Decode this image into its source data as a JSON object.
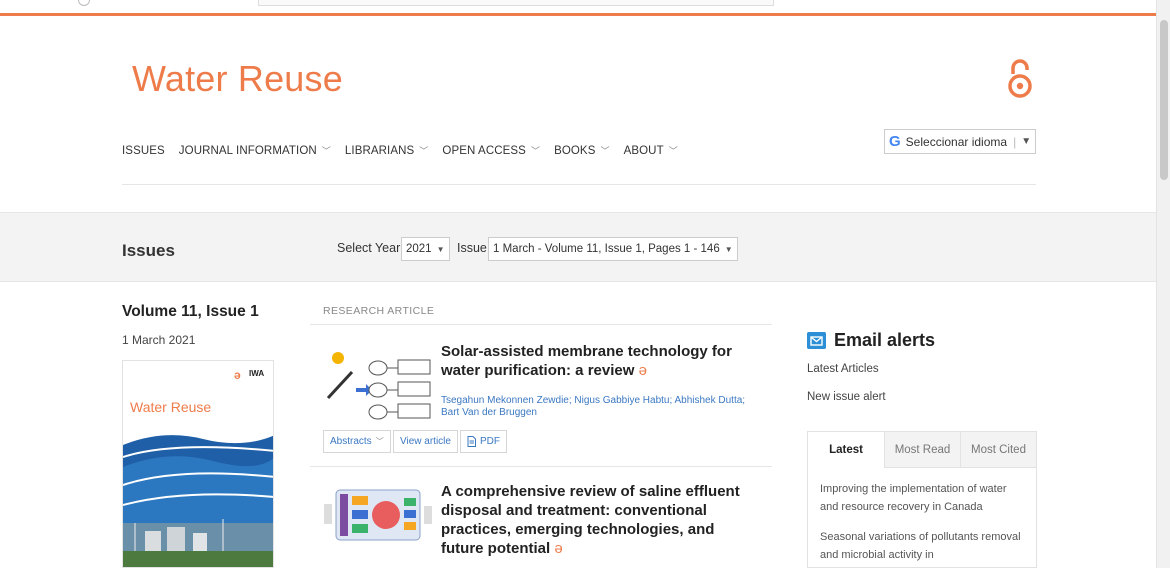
{
  "header": {
    "journal_title": "Water Reuse",
    "nav": [
      "ISSUES",
      "JOURNAL INFORMATION",
      "LIBRARIANS",
      "OPEN ACCESS",
      "BOOKS",
      "ABOUT"
    ],
    "translate_label": "Seleccionar idioma",
    "translate_icon": "G"
  },
  "issues_bar": {
    "title": "Issues",
    "select_year_label": "Select Year",
    "year_value": "2021",
    "issue_label": "Issue",
    "issue_value": "1 March - Volume 11, Issue 1, Pages 1 - 146"
  },
  "volume": {
    "title": "Volume 11, Issue 1",
    "date": "1 March 2021",
    "cover_title": "Water Reuse",
    "cover_publisher": "IWA"
  },
  "articles": {
    "section_label": "RESEARCH ARTICLE",
    "items": [
      {
        "title": "Solar-assisted membrane technology for water purification: a review",
        "authors": "Tsegahun Mekonnen Zewdie; Nigus Gabbiye Habtu; Abhishek Dutta; Bart Van der Bruggen",
        "buttons": {
          "abstracts": "Abstracts",
          "view": "View article",
          "pdf": "PDF"
        }
      },
      {
        "title": "A comprehensive review of saline effluent disposal and treatment: conventional practices, emerging technologies, and future potential"
      }
    ]
  },
  "sidebar": {
    "email_title": "Email alerts",
    "latest_articles": "Latest Articles",
    "new_issue_alert": "New issue alert",
    "tabs": [
      "Latest",
      "Most Read",
      "Most Cited"
    ],
    "latest_items": [
      "Improving the implementation of water and resource recovery in Canada",
      "Seasonal variations of pollutants removal and microbial activity in"
    ]
  },
  "colors": {
    "accent": "#ee7c4a",
    "link": "#3b78c2",
    "email_icon": "#2d8fd5"
  }
}
